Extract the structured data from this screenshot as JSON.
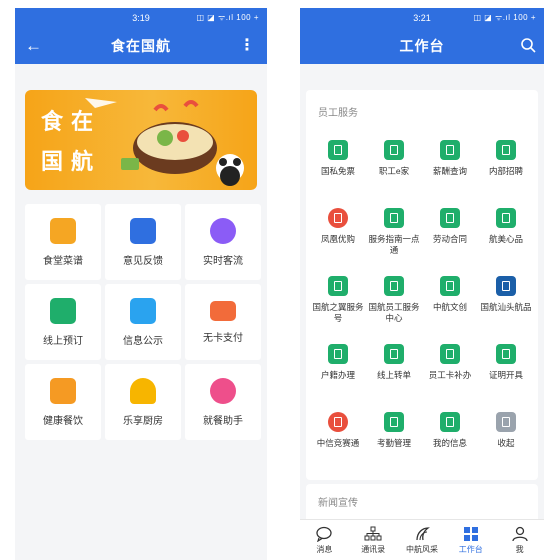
{
  "left": {
    "status_time": "3:19",
    "status_right": "◫ ◪ ᯤ.ıl 100 +",
    "title": "食在国航",
    "banner": {
      "line1": "食在",
      "line2": "国航"
    },
    "items": [
      {
        "label": "食堂菜谱",
        "color": "#f5a623"
      },
      {
        "label": "意见反馈",
        "color": "#2f6fe0"
      },
      {
        "label": "实时客流",
        "color": "#8b5cf6"
      },
      {
        "label": "线上预订",
        "color": "#1fae6b"
      },
      {
        "label": "信息公示",
        "color": "#2aa3ef"
      },
      {
        "label": "无卡支付",
        "color": "#f26b3a"
      },
      {
        "label": "健康餐饮",
        "color": "#f59a23"
      },
      {
        "label": "乐享厨房",
        "color": "#f7b500"
      },
      {
        "label": "就餐助手",
        "color": "#ee4f8b"
      }
    ]
  },
  "right": {
    "status_time": "3:21",
    "status_right": "◫ ◪ ᯤ.ıl 100 +",
    "title": "工作台",
    "section1": "员工服务",
    "section2": "新闻宣传",
    "services": [
      "国私免票",
      "职工e家",
      "薪酬查询",
      "内部招聘",
      "凤凰优购",
      "服务指南一点通",
      "劳动合同",
      "航美心品",
      "国航之翼服务号",
      "国航员工服务中心",
      "中航文创",
      "国航汕头航品",
      "户籍办理",
      "线上转单",
      "员工卡补办",
      "证明开具",
      "中信竞赛通",
      "考勤管理",
      "我的信息",
      "收起"
    ],
    "tabs": [
      {
        "label": "消息"
      },
      {
        "label": "通讯录"
      },
      {
        "label": "中航风采"
      },
      {
        "label": "工作台",
        "active": true
      },
      {
        "label": "我"
      }
    ]
  }
}
